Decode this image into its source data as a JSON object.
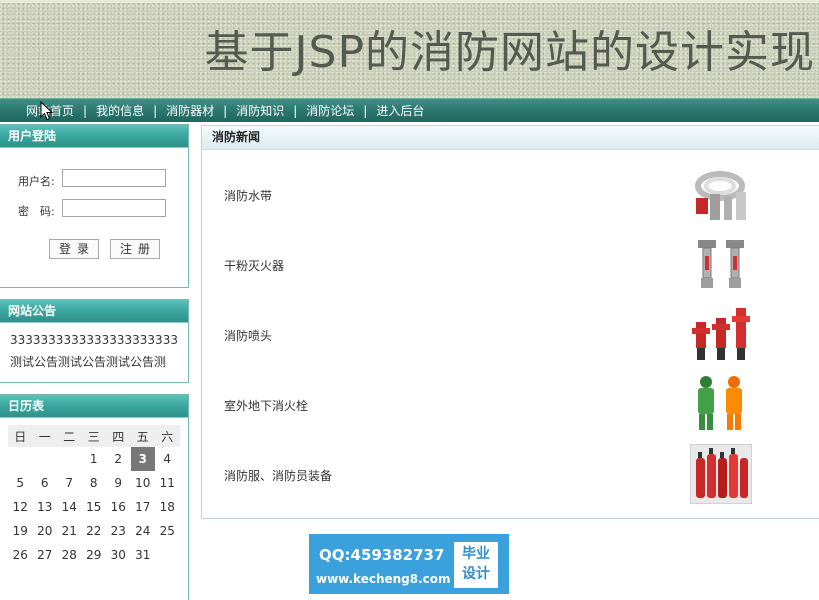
{
  "banner": {
    "title": "基于JSP的消防网站的设计实现"
  },
  "nav": {
    "items": [
      "网站首页",
      "我的信息",
      "消防器材",
      "消防知识",
      "消防论坛",
      "进入后台"
    ],
    "separator": "|"
  },
  "login": {
    "title": "用户登陆",
    "username_label": "用户名:",
    "password_label": "密　码:",
    "login_button": "登录",
    "register_button": "注册"
  },
  "notice": {
    "title": "网站公告",
    "lines": [
      "3333333333333333333333",
      "测试公告测试公告测试公告测"
    ]
  },
  "calendar": {
    "title": "日历表",
    "weekdays": [
      "日",
      "一",
      "二",
      "三",
      "四",
      "五",
      "六"
    ],
    "weeks": [
      [
        "",
        "",
        "",
        "1",
        "2",
        "3",
        "4"
      ],
      [
        "5",
        "6",
        "7",
        "8",
        "9",
        "10",
        "11"
      ],
      [
        "12",
        "13",
        "14",
        "15",
        "16",
        "17",
        "18"
      ],
      [
        "19",
        "20",
        "21",
        "22",
        "23",
        "24",
        "25"
      ],
      [
        "26",
        "27",
        "28",
        "29",
        "30",
        "31",
        ""
      ]
    ],
    "today": "3"
  },
  "news": {
    "title": "消防新闻",
    "items": [
      {
        "label": "消防水带",
        "image": "hose-image"
      },
      {
        "label": "干粉灭火器",
        "image": "sprinkler-image"
      },
      {
        "label": "消防喷头",
        "image": "hydrant-image"
      },
      {
        "label": "室外地下消火栓",
        "image": "firesuit-image"
      },
      {
        "label": "消防服、消防员装备",
        "image": "extinguisher-image"
      }
    ]
  },
  "ad": {
    "qq": "QQ:459382737",
    "url": "www.kecheng8.com",
    "badge_line1": "毕业",
    "badge_line2": "设计"
  },
  "colors": {
    "nav": "#2a756c",
    "panel_head": "#3aa69e",
    "ad": "#3aa1dc"
  }
}
